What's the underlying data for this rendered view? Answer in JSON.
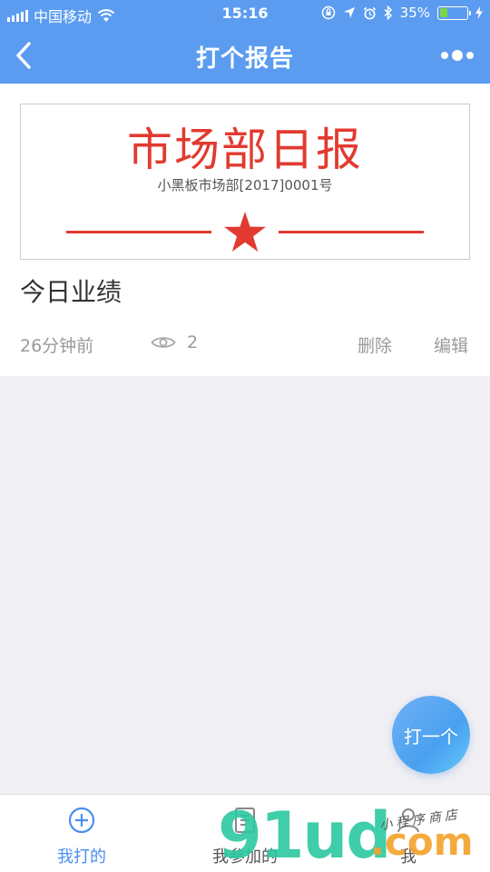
{
  "status_bar": {
    "carrier": "中国移动",
    "time": "15:16",
    "battery_percent": "35%",
    "battery_level": 0.35
  },
  "nav": {
    "title": "打个报告",
    "back_icon": "chevron-left-icon",
    "more_icon": "more-dots-icon"
  },
  "report": {
    "banner_heading": "市场部日报",
    "banner_doc_number": "小黑板市场部[2017]0001号",
    "title": "今日业绩",
    "time_ago": "26分钟前",
    "views": "2",
    "delete_label": "删除",
    "edit_label": "编辑"
  },
  "fab": {
    "label": "打一个"
  },
  "tabbar": {
    "items": [
      {
        "label": "我打的",
        "icon": "plus-circle-icon",
        "active": true
      },
      {
        "label": "我参加的",
        "icon": "document-icon",
        "active": false
      },
      {
        "label": "我",
        "icon": "person-icon",
        "active": false
      }
    ]
  },
  "watermark": {
    "brand": "91ud",
    "domain": ".com",
    "tagline": "小程序商店"
  },
  "colors": {
    "nav_blue": "#5b9cf0",
    "banner_red": "#e23a30",
    "active_tab": "#4a8ef0"
  }
}
